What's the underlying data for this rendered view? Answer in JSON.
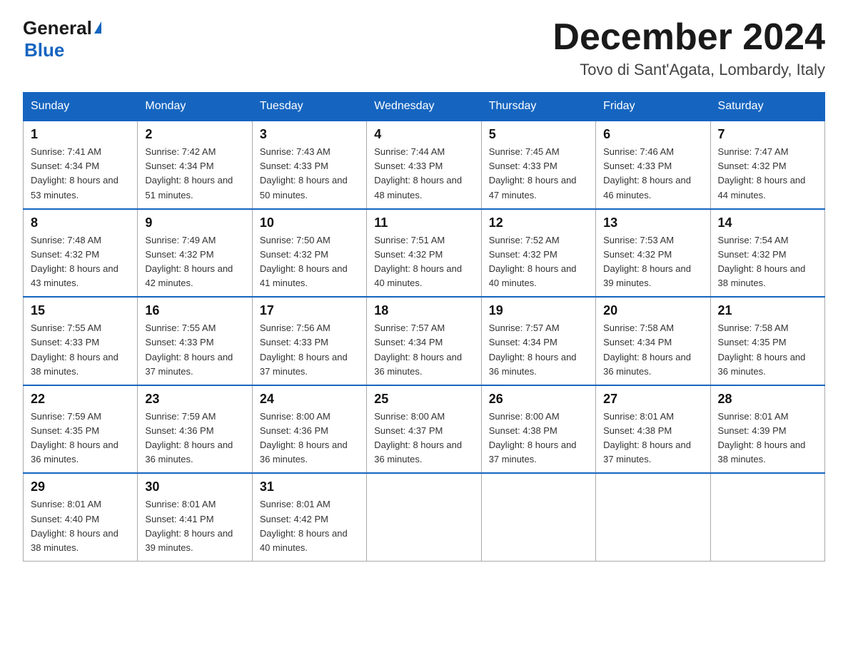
{
  "logo": {
    "general": "General",
    "blue": "Blue",
    "triangle": "▶"
  },
  "header": {
    "month": "December 2024",
    "location": "Tovo di Sant'Agata, Lombardy, Italy"
  },
  "weekdays": [
    "Sunday",
    "Monday",
    "Tuesday",
    "Wednesday",
    "Thursday",
    "Friday",
    "Saturday"
  ],
  "weeks": [
    [
      {
        "day": "1",
        "sunrise": "7:41 AM",
        "sunset": "4:34 PM",
        "daylight": "8 hours and 53 minutes."
      },
      {
        "day": "2",
        "sunrise": "7:42 AM",
        "sunset": "4:34 PM",
        "daylight": "8 hours and 51 minutes."
      },
      {
        "day": "3",
        "sunrise": "7:43 AM",
        "sunset": "4:33 PM",
        "daylight": "8 hours and 50 minutes."
      },
      {
        "day": "4",
        "sunrise": "7:44 AM",
        "sunset": "4:33 PM",
        "daylight": "8 hours and 48 minutes."
      },
      {
        "day": "5",
        "sunrise": "7:45 AM",
        "sunset": "4:33 PM",
        "daylight": "8 hours and 47 minutes."
      },
      {
        "day": "6",
        "sunrise": "7:46 AM",
        "sunset": "4:33 PM",
        "daylight": "8 hours and 46 minutes."
      },
      {
        "day": "7",
        "sunrise": "7:47 AM",
        "sunset": "4:32 PM",
        "daylight": "8 hours and 44 minutes."
      }
    ],
    [
      {
        "day": "8",
        "sunrise": "7:48 AM",
        "sunset": "4:32 PM",
        "daylight": "8 hours and 43 minutes."
      },
      {
        "day": "9",
        "sunrise": "7:49 AM",
        "sunset": "4:32 PM",
        "daylight": "8 hours and 42 minutes."
      },
      {
        "day": "10",
        "sunrise": "7:50 AM",
        "sunset": "4:32 PM",
        "daylight": "8 hours and 41 minutes."
      },
      {
        "day": "11",
        "sunrise": "7:51 AM",
        "sunset": "4:32 PM",
        "daylight": "8 hours and 40 minutes."
      },
      {
        "day": "12",
        "sunrise": "7:52 AM",
        "sunset": "4:32 PM",
        "daylight": "8 hours and 40 minutes."
      },
      {
        "day": "13",
        "sunrise": "7:53 AM",
        "sunset": "4:32 PM",
        "daylight": "8 hours and 39 minutes."
      },
      {
        "day": "14",
        "sunrise": "7:54 AM",
        "sunset": "4:32 PM",
        "daylight": "8 hours and 38 minutes."
      }
    ],
    [
      {
        "day": "15",
        "sunrise": "7:55 AM",
        "sunset": "4:33 PM",
        "daylight": "8 hours and 38 minutes."
      },
      {
        "day": "16",
        "sunrise": "7:55 AM",
        "sunset": "4:33 PM",
        "daylight": "8 hours and 37 minutes."
      },
      {
        "day": "17",
        "sunrise": "7:56 AM",
        "sunset": "4:33 PM",
        "daylight": "8 hours and 37 minutes."
      },
      {
        "day": "18",
        "sunrise": "7:57 AM",
        "sunset": "4:34 PM",
        "daylight": "8 hours and 36 minutes."
      },
      {
        "day": "19",
        "sunrise": "7:57 AM",
        "sunset": "4:34 PM",
        "daylight": "8 hours and 36 minutes."
      },
      {
        "day": "20",
        "sunrise": "7:58 AM",
        "sunset": "4:34 PM",
        "daylight": "8 hours and 36 minutes."
      },
      {
        "day": "21",
        "sunrise": "7:58 AM",
        "sunset": "4:35 PM",
        "daylight": "8 hours and 36 minutes."
      }
    ],
    [
      {
        "day": "22",
        "sunrise": "7:59 AM",
        "sunset": "4:35 PM",
        "daylight": "8 hours and 36 minutes."
      },
      {
        "day": "23",
        "sunrise": "7:59 AM",
        "sunset": "4:36 PM",
        "daylight": "8 hours and 36 minutes."
      },
      {
        "day": "24",
        "sunrise": "8:00 AM",
        "sunset": "4:36 PM",
        "daylight": "8 hours and 36 minutes."
      },
      {
        "day": "25",
        "sunrise": "8:00 AM",
        "sunset": "4:37 PM",
        "daylight": "8 hours and 36 minutes."
      },
      {
        "day": "26",
        "sunrise": "8:00 AM",
        "sunset": "4:38 PM",
        "daylight": "8 hours and 37 minutes."
      },
      {
        "day": "27",
        "sunrise": "8:01 AM",
        "sunset": "4:38 PM",
        "daylight": "8 hours and 37 minutes."
      },
      {
        "day": "28",
        "sunrise": "8:01 AM",
        "sunset": "4:39 PM",
        "daylight": "8 hours and 38 minutes."
      }
    ],
    [
      {
        "day": "29",
        "sunrise": "8:01 AM",
        "sunset": "4:40 PM",
        "daylight": "8 hours and 38 minutes."
      },
      {
        "day": "30",
        "sunrise": "8:01 AM",
        "sunset": "4:41 PM",
        "daylight": "8 hours and 39 minutes."
      },
      {
        "day": "31",
        "sunrise": "8:01 AM",
        "sunset": "4:42 PM",
        "daylight": "8 hours and 40 minutes."
      },
      null,
      null,
      null,
      null
    ]
  ]
}
